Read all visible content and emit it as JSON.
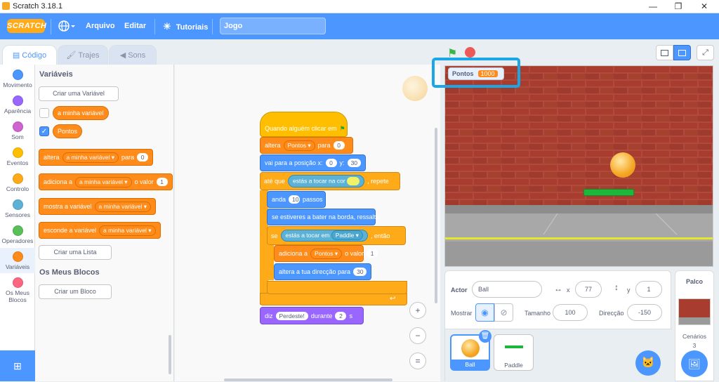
{
  "window": {
    "title": "Scratch 3.18.1",
    "minimize": "—",
    "maximize": "❐",
    "close": "✕"
  },
  "menubar": {
    "logo": "SCRATCH",
    "language": "",
    "file": "Arquivo",
    "edit": "Editar",
    "tutorials": "Tutoriais",
    "project_title": "Jogo"
  },
  "tabs": [
    {
      "label": "Código"
    },
    {
      "label": "Trajes"
    },
    {
      "label": "Sons"
    }
  ],
  "categories": [
    {
      "label": "Movimento",
      "color": "#4c97ff"
    },
    {
      "label": "Aparência",
      "color": "#9966ff"
    },
    {
      "label": "Som",
      "color": "#cf63cf"
    },
    {
      "label": "Eventos",
      "color": "#ffbf00"
    },
    {
      "label": "Controlo",
      "color": "#ffab19"
    },
    {
      "label": "Sensores",
      "color": "#5cb1d6"
    },
    {
      "label": "Operadores",
      "color": "#59c059"
    },
    {
      "label": "Variáveis",
      "color": "#ff8c1a"
    },
    {
      "label": "Os Meus Blocos",
      "color": "#ff6680"
    }
  ],
  "palette": {
    "heading_vars": "Variáveis",
    "create_var": "Criar uma Variável",
    "var1": "a minha variável",
    "var2": "Pontos",
    "set_label": "altera",
    "set_var": "a minha variável",
    "set_to": "para",
    "set_val": "0",
    "change_label": "adiciona a",
    "change_var": "a minha variável",
    "change_by": "o valor",
    "change_val": "1",
    "show_label": "mostra a variável",
    "show_var": "a minha variável",
    "hide_label": "esconde a variável",
    "hide_var": "a minha variável",
    "create_list": "Criar uma Lista",
    "heading_blocks": "Os Meus Blocos",
    "create_block": "Criar um Bloco"
  },
  "script": {
    "hat": "Quando alguém clicar em",
    "set_label": "altera",
    "set_var": "Pontos",
    "set_to": "para",
    "set_val": "0",
    "goto_label": "vai para a posição x:",
    "goto_x": "0",
    "goto_y_label": "y:",
    "goto_y": "30",
    "until_label": "até que",
    "touching_color": "estás a tocar na cor",
    "repeat_label": ", repete",
    "move_label": "anda",
    "move_val": "10",
    "move_unit": "passos",
    "bounce": "se estiveres a bater na borda, ressalta",
    "if_label": "se",
    "touching": "estás a tocar em",
    "touching_obj": "Paddle",
    "then_label": ", então",
    "change_label": "adiciona a",
    "change_var": "Pontos",
    "change_by": "o valor",
    "change_val": "1",
    "dir_label": "altera a tua direcção para",
    "dir_val": "30",
    "say_label": "diz",
    "say_text": "Perdeste!",
    "say_dur_label": "durante",
    "say_dur": "2",
    "say_unit": "s",
    "zoom_in": "+",
    "zoom_out": "−",
    "zoom_reset": "="
  },
  "stage": {
    "monitor_label": "Pontos",
    "monitor_value": "1000"
  },
  "sprite": {
    "actor_label": "Actor",
    "actor_name": "Ball",
    "x_label": "x",
    "x_val": "77",
    "y_label": "y",
    "y_val": "1",
    "show_label": "Mostrar",
    "size_label": "Tamanho",
    "size_val": "100",
    "dir_label": "Direcção",
    "dir_val": "-150",
    "sprites": [
      {
        "name": "Ball"
      },
      {
        "name": "Paddle"
      }
    ]
  },
  "stage_panel": {
    "title": "Palco",
    "backdrops_label": "Cenários",
    "backdrops_count": "3"
  }
}
